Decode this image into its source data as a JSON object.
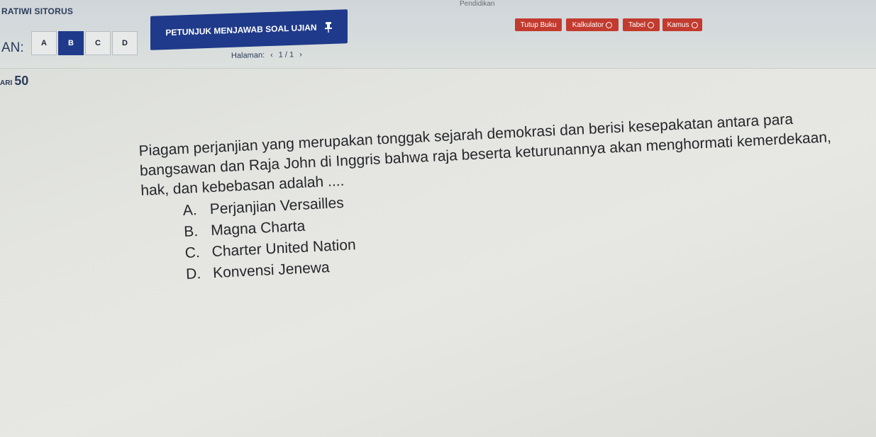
{
  "header": {
    "student_name": "RATIWI SITORUS",
    "top_right_text": "Pendidikan",
    "font_size_label": "AN:",
    "font_buttons": [
      "A",
      "B",
      "C",
      "D"
    ],
    "active_font_button": "B",
    "guide_label": "PETUNJUK MENJAWAB SOAL UJIAN",
    "tools": {
      "close_book": "Tutup Buku",
      "calculator": "Kalkulator",
      "table": "Tabel",
      "dictionary": "Kamus"
    },
    "pager": {
      "label": "Halaman:",
      "prev": "‹",
      "current": "1 / 1",
      "next": "›"
    }
  },
  "question": {
    "number_prefix": "ARI",
    "number": "50",
    "text": "Piagam perjanjian yang merupakan tonggak sejarah demokrasi dan berisi kesepakatan antara para bangsawan dan Raja John di Inggris bahwa raja beserta keturunannya akan menghormati kemerdekaan, hak, dan kebebasan adalah ....",
    "options": [
      {
        "letter": "A.",
        "text": "Perjanjian Versailles"
      },
      {
        "letter": "B.",
        "text": "Magna Charta"
      },
      {
        "letter": "C.",
        "text": "Charter United Nation"
      },
      {
        "letter": "D.",
        "text": "Konvensi Jenewa"
      }
    ]
  },
  "colors": {
    "primary": "#1f3a8a",
    "tool_red": "#c23b2e",
    "background": "#e4e5e1"
  },
  "icons": {
    "guide": "pin-icon",
    "tool_help": "circle-icon"
  }
}
